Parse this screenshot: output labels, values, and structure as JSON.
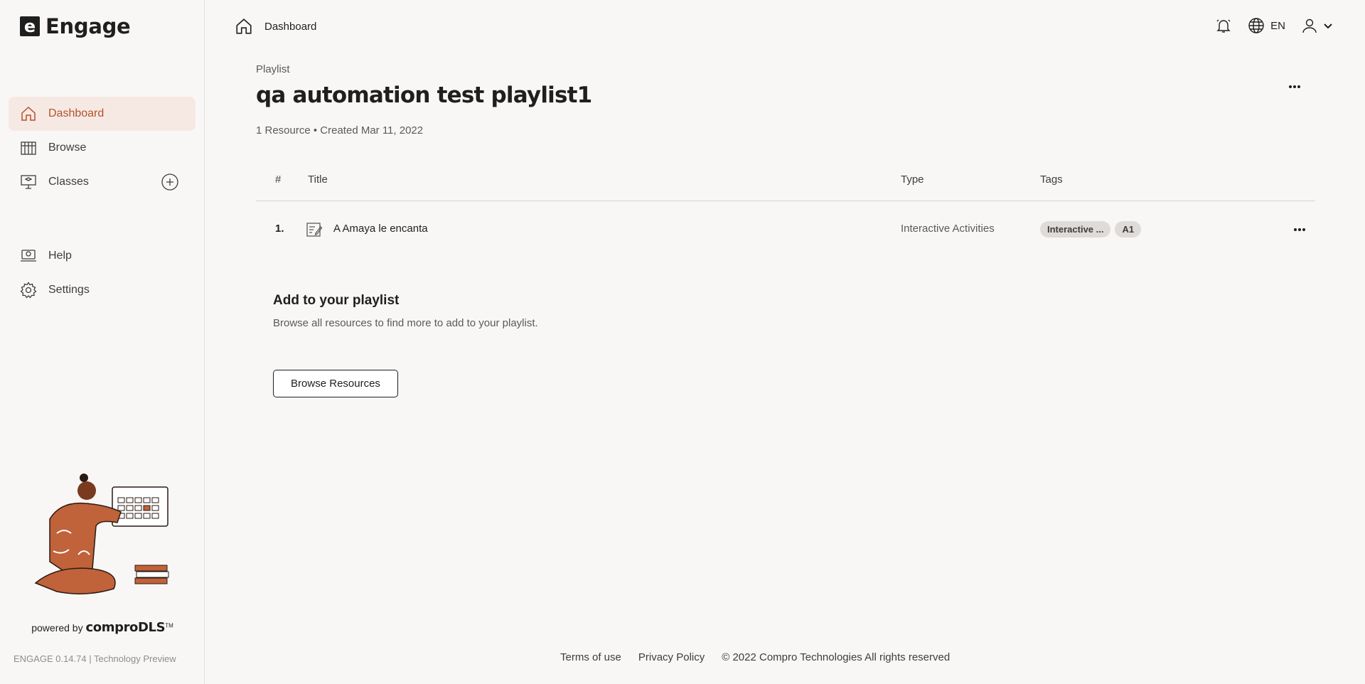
{
  "brand": {
    "logo_letter": "e",
    "name": "Engage"
  },
  "sidebar": {
    "items": [
      {
        "label": "Dashboard",
        "icon": "home-icon",
        "active": true
      },
      {
        "label": "Browse",
        "icon": "books-icon"
      },
      {
        "label": "Classes",
        "icon": "classroom-icon"
      },
      {
        "label": "Help",
        "icon": "help-icon"
      },
      {
        "label": "Settings",
        "icon": "gear-icon"
      }
    ],
    "powered_prefix": "powered by",
    "powered_brand": "comproDLS",
    "powered_tm": "TM",
    "version": "ENGAGE 0.14.74 | Technology Preview"
  },
  "header": {
    "breadcrumb": "Dashboard",
    "language": "EN"
  },
  "page": {
    "kicker": "Playlist",
    "title": "qa automation test playlist1",
    "meta": "1 Resource • Created Mar 11, 2022"
  },
  "table": {
    "columns": [
      "#",
      "Title",
      "Type",
      "Tags"
    ],
    "rows": [
      {
        "index": "1.",
        "title": "A Amaya le encanta",
        "type": "Interactive Activities",
        "tags": [
          "Interactive ...",
          "A1"
        ]
      }
    ]
  },
  "add_section": {
    "heading": "Add to your playlist",
    "description": "Browse all resources to find more to add to your playlist.",
    "button": "Browse Resources"
  },
  "footer": {
    "terms": "Terms of use",
    "privacy": "Privacy Policy",
    "copyright": "© 2022 Compro Technologies All rights reserved"
  },
  "colors": {
    "accent": "#b5512b",
    "active_bg": "#f6e9e4",
    "background": "#f9f7f5"
  }
}
